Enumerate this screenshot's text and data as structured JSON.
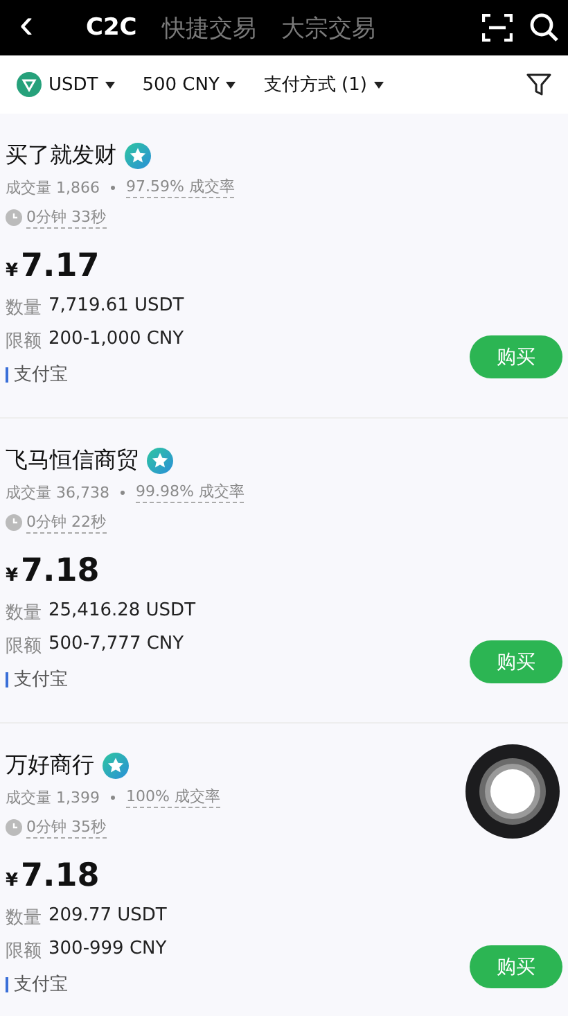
{
  "header": {
    "back": "‹",
    "tabs": [
      {
        "label": "C2C",
        "selected": true
      },
      {
        "label": "快捷交易",
        "selected": false
      },
      {
        "label": "大宗交易",
        "selected": false
      }
    ]
  },
  "filters": [
    {
      "kind": "coin",
      "label": "USDT"
    },
    {
      "kind": "plain",
      "label": "500 CNY"
    },
    {
      "kind": "plain",
      "label": "支付方式 (1)"
    }
  ],
  "offers": [
    {
      "merchant": "买了就发财",
      "volume_label": "成交量",
      "volume": "1,866",
      "rate": "97.59% 成交率",
      "time": "0分钟 33秒",
      "currency": "¥",
      "price": "7.17",
      "amount_label": "数量",
      "amount": "7,719.61 USDT",
      "limit_label": "限额",
      "limit": "200-1,000 CNY",
      "payment": "支付宝",
      "button": "购买"
    },
    {
      "merchant": "飞马恒信商贸",
      "volume_label": "成交量",
      "volume": "36,738",
      "rate": "99.98% 成交率",
      "time": "0分钟 22秒",
      "currency": "¥",
      "price": "7.18",
      "amount_label": "数量",
      "amount": "25,416.28 USDT",
      "limit_label": "限额",
      "limit": "500-7,777 CNY",
      "payment": "支付宝",
      "button": "购买"
    },
    {
      "merchant": "万好商行",
      "volume_label": "成交量",
      "volume": "1,399",
      "rate": "100% 成交率",
      "time": "0分钟 35秒",
      "currency": "¥",
      "price": "7.18",
      "amount_label": "数量",
      "amount": "209.77 USDT",
      "limit_label": "限额",
      "limit": "300-999 CNY",
      "payment": "支付宝",
      "button": "购买"
    }
  ]
}
